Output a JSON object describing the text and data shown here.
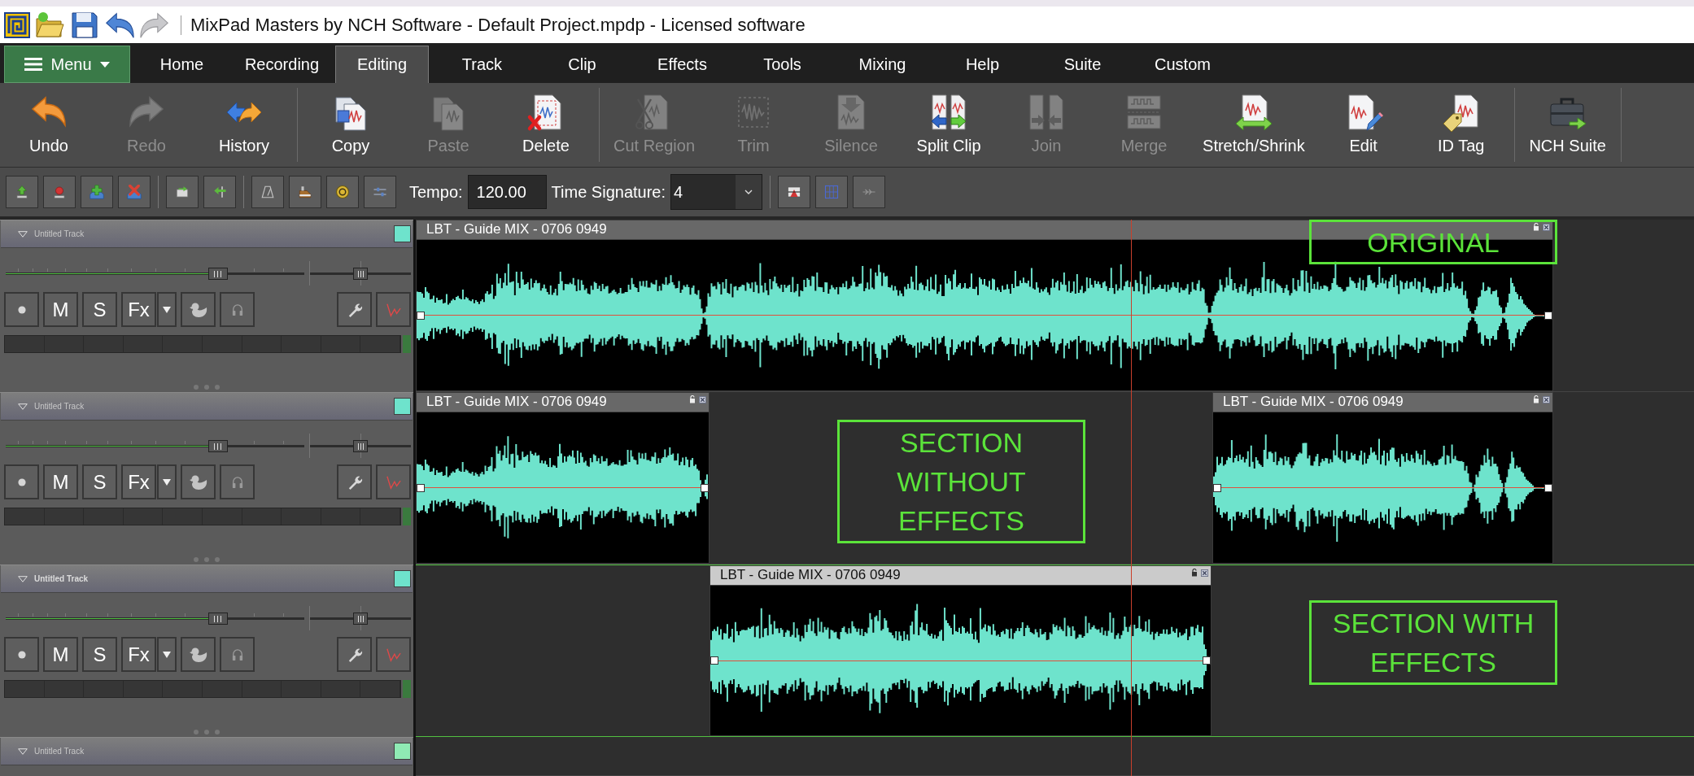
{
  "window": {
    "title": "MixPad Masters by NCH Software - Default Project.mpdp - Licensed software"
  },
  "menu_button": {
    "label": "Menu"
  },
  "tabs": [
    {
      "label": "Home",
      "selected": false
    },
    {
      "label": "Recording",
      "selected": false
    },
    {
      "label": "Editing",
      "selected": true
    },
    {
      "label": "Track",
      "selected": false
    },
    {
      "label": "Clip",
      "selected": false
    },
    {
      "label": "Effects",
      "selected": false
    },
    {
      "label": "Tools",
      "selected": false
    },
    {
      "label": "Mixing",
      "selected": false
    },
    {
      "label": "Help",
      "selected": false
    },
    {
      "label": "Suite",
      "selected": false
    },
    {
      "label": "Custom",
      "selected": false
    }
  ],
  "ribbon": [
    {
      "items": [
        {
          "label": "Undo",
          "disabled": false
        },
        {
          "label": "Redo",
          "disabled": true
        },
        {
          "label": "History",
          "disabled": false
        }
      ]
    },
    {
      "items": [
        {
          "label": "Copy",
          "disabled": false
        },
        {
          "label": "Paste",
          "disabled": true
        },
        {
          "label": "Delete",
          "disabled": false
        }
      ]
    },
    {
      "items": [
        {
          "label": "Cut Region",
          "disabled": true
        },
        {
          "label": "Trim",
          "disabled": true
        },
        {
          "label": "Silence",
          "disabled": true
        },
        {
          "label": "Split Clip",
          "disabled": false
        },
        {
          "label": "Join",
          "disabled": true
        },
        {
          "label": "Merge",
          "disabled": true
        },
        {
          "label": "Stretch/Shrink",
          "disabled": false
        },
        {
          "label": "Edit",
          "disabled": false
        },
        {
          "label": "ID Tag",
          "disabled": false
        }
      ]
    },
    {
      "items": [
        {
          "label": "NCH Suite",
          "disabled": false
        }
      ]
    }
  ],
  "toolbar": {
    "tempo": {
      "label": "Tempo:",
      "value": "120.00"
    },
    "time_signature": {
      "label": "Time Signature:",
      "value": "4"
    }
  },
  "tracks": [
    {
      "name": "Untitled Track",
      "selected": false,
      "color": "#6ee3cc",
      "volume": {
        "level": 0.71
      },
      "pan": {
        "level": 0.5
      },
      "mute_label": "M",
      "solo_label": "S",
      "fx_label": "Fx",
      "clips": [
        {
          "title": "LBT - Guide MIX - 0706 0949",
          "selected": false
        }
      ]
    },
    {
      "name": "Untitled Track",
      "selected": false,
      "color": "#6ee3cc",
      "volume": {
        "level": 0.71
      },
      "pan": {
        "level": 0.5
      },
      "mute_label": "M",
      "solo_label": "S",
      "fx_label": "Fx",
      "clips": [
        {
          "title": "LBT - Guide MIX - 0706 0949",
          "selected": false
        },
        {
          "title": "LBT - Guide MIX - 0706 0949",
          "selected": false
        }
      ]
    },
    {
      "name": "Untitled Track",
      "selected": true,
      "color": "#6ee3cc",
      "volume": {
        "level": 0.71
      },
      "pan": {
        "level": 0.5
      },
      "mute_label": "M",
      "solo_label": "S",
      "fx_label": "Fx",
      "clips": [
        {
          "title": "LBT - Guide MIX - 0706 0949",
          "selected": true
        }
      ]
    },
    {
      "name": "Untitled Track",
      "selected": false,
      "color": "#8feab4"
    }
  ],
  "annotations": [
    {
      "text": "ORIGINAL"
    },
    {
      "text": "SECTION WITHOUT EFFECTS"
    },
    {
      "text": "SECTION WITH EFFECTS"
    }
  ]
}
